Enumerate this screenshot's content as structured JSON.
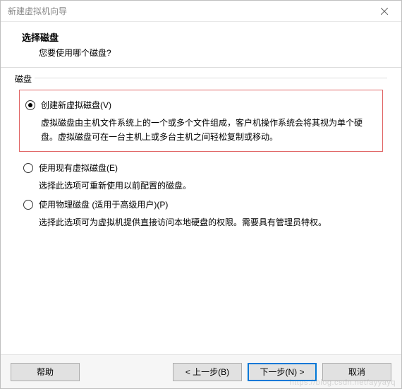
{
  "window": {
    "title": "新建虚拟机向导"
  },
  "header": {
    "title": "选择磁盘",
    "subtitle": "您要使用哪个磁盘?"
  },
  "group": {
    "legend": "磁盘"
  },
  "options": [
    {
      "label": "创建新虚拟磁盘(V)",
      "desc": "虚拟磁盘由主机文件系统上的一个或多个文件组成，客户机操作系统会将其视为单个硬盘。虚拟磁盘可在一台主机上或多台主机之间轻松复制或移动。",
      "checked": true,
      "highlight": true
    },
    {
      "label": "使用现有虚拟磁盘(E)",
      "desc": "选择此选项可重新使用以前配置的磁盘。",
      "checked": false,
      "highlight": false
    },
    {
      "label": "使用物理磁盘 (适用于高级用户)(P)",
      "desc": "选择此选项可为虚拟机提供直接访问本地硬盘的权限。需要具有管理员特权。",
      "checked": false,
      "highlight": false
    }
  ],
  "buttons": {
    "help": "帮助",
    "back": "< 上一步(B)",
    "next": "下一步(N) >",
    "cancel": "取消"
  },
  "watermark": "https://blog.csdn.net/ayyayq"
}
